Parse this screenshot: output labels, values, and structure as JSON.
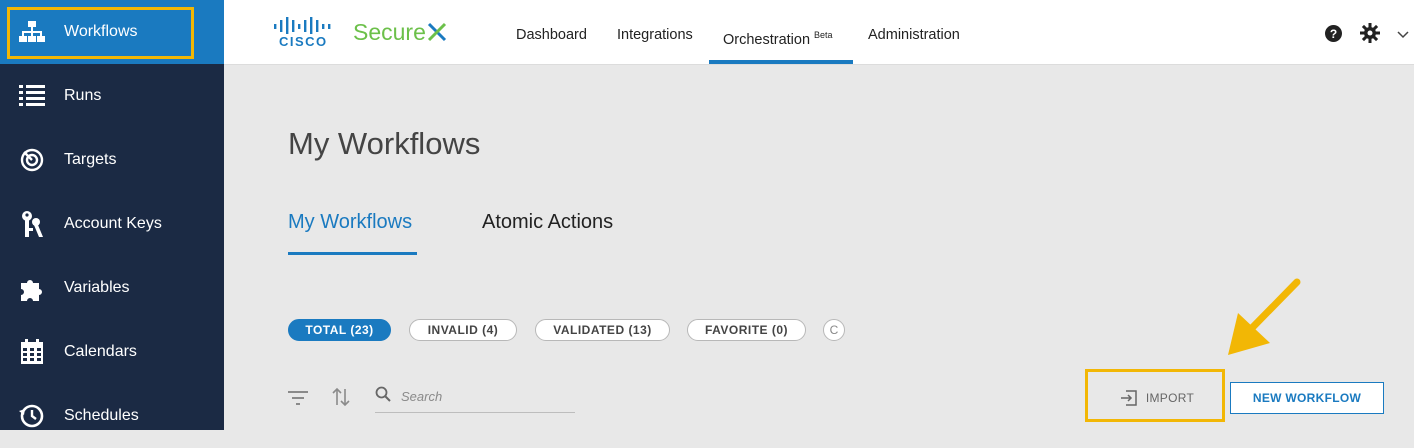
{
  "sidebar": {
    "items": [
      {
        "label": "Workflows",
        "icon": "workflow-tree-icon",
        "active": true
      },
      {
        "label": "Runs",
        "icon": "list-icon"
      },
      {
        "label": "Targets",
        "icon": "target-icon"
      },
      {
        "label": "Account Keys",
        "icon": "keys-icon"
      },
      {
        "label": "Variables",
        "icon": "puzzle-icon"
      },
      {
        "label": "Calendars",
        "icon": "calendar-icon"
      },
      {
        "label": "Schedules",
        "icon": "schedule-clock-icon"
      }
    ]
  },
  "header": {
    "logo_text": "CISCO",
    "brand_text": "Secure",
    "nav": [
      {
        "label": "Dashboard"
      },
      {
        "label": "Integrations"
      },
      {
        "label": "Orchestration",
        "badge": "Beta",
        "active": true
      },
      {
        "label": "Administration"
      }
    ],
    "icons": [
      "help-icon",
      "gear-icon",
      "chevron-down-icon"
    ]
  },
  "main": {
    "title": "My Workflows",
    "tabs": [
      {
        "label": "My Workflows",
        "active": true
      },
      {
        "label": "Atomic Actions"
      }
    ],
    "filters": [
      {
        "label": "TOTAL (23)",
        "active": true
      },
      {
        "label": "INVALID (4)"
      },
      {
        "label": "VALIDATED (13)"
      },
      {
        "label": "FAVORITE (0)"
      }
    ],
    "refresh_glyph": "C",
    "search": {
      "placeholder": "Search",
      "value": ""
    },
    "import_label": "IMPORT",
    "new_workflow_label": "NEW WORKFLOW"
  },
  "annotations": {
    "highlight_color": "#f2b705"
  },
  "colors": {
    "sidebar": "#1b2a44",
    "accent": "#1a7ac0",
    "brand_green": "#6cc04a"
  }
}
